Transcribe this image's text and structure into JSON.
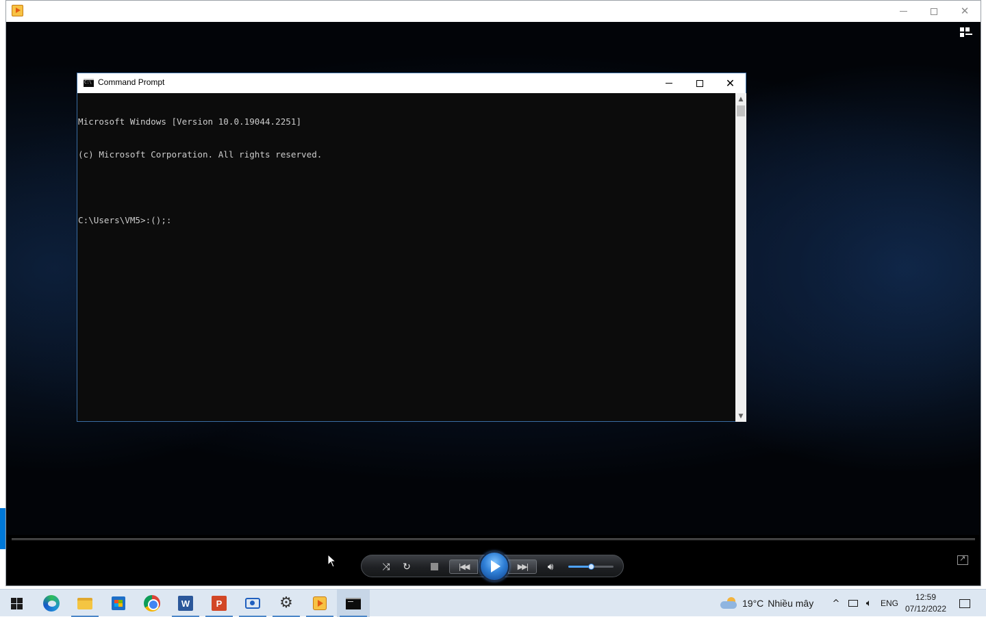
{
  "player": {
    "title": "",
    "controls": {
      "shuffle_icon": "shuffle-icon",
      "repeat_icon": "repeat-icon",
      "stop_icon": "stop-icon",
      "previous_icon": "previous-icon",
      "play_icon": "play-icon",
      "next_icon": "next-icon",
      "mute_icon": "volume-icon",
      "volume_level": 0.5
    }
  },
  "cmd": {
    "title": "Command Prompt",
    "lines": [
      "Microsoft Windows [Version 10.0.19044.2251]",
      "(c) Microsoft Corporation. All rights reserved.",
      "",
      "C:\\Users\\VM5>:();:"
    ]
  },
  "taskbar": {
    "pinned": [
      {
        "name": "start",
        "icon": "windows-logo-icon"
      },
      {
        "name": "edge",
        "icon": "edge-icon"
      },
      {
        "name": "file-explorer",
        "icon": "folder-icon"
      },
      {
        "name": "microsoft-store",
        "icon": "store-icon"
      },
      {
        "name": "chrome",
        "icon": "chrome-icon"
      },
      {
        "name": "word",
        "icon": "word-icon",
        "glyph": "W"
      },
      {
        "name": "powerpoint",
        "icon": "powerpoint-icon",
        "glyph": "P"
      },
      {
        "name": "snipping-tool",
        "icon": "camera-icon"
      },
      {
        "name": "settings",
        "icon": "gear-icon"
      },
      {
        "name": "media-player",
        "icon": "media-player-icon"
      },
      {
        "name": "command-prompt",
        "icon": "cmd-icon"
      }
    ],
    "weather": {
      "temperature": "19°C",
      "condition": "Nhiều mây"
    },
    "language": "ENG",
    "clock": {
      "time": "12:59",
      "date": "07/12/2022"
    }
  },
  "colors": {
    "accent": "#0078d7",
    "console_bg": "#0c0c0c",
    "console_text": "#cccccc",
    "taskbar_bg": "#dde7f2",
    "play_button": "#2f7fd6"
  }
}
